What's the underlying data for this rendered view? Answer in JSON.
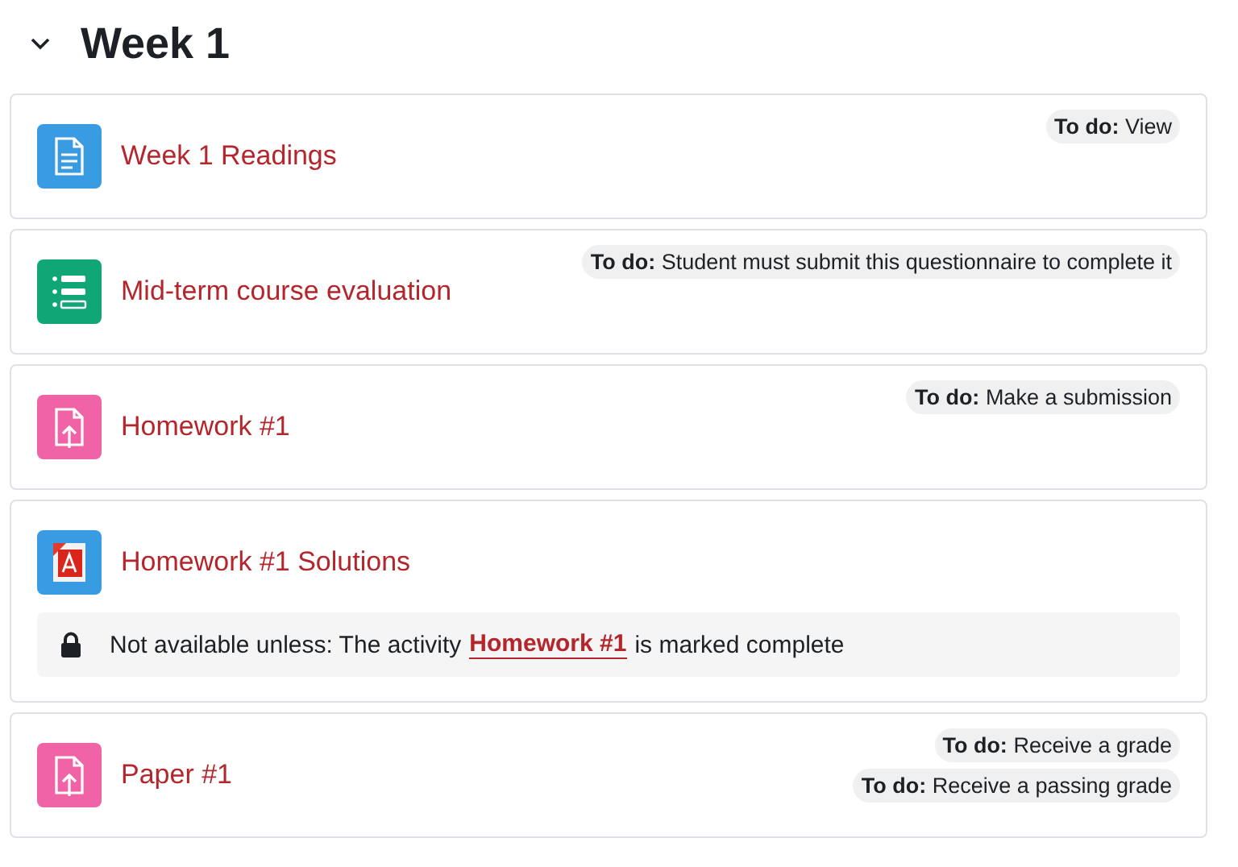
{
  "section": {
    "title": "Week 1",
    "expanded": true
  },
  "activities": [
    {
      "kind": "page",
      "title": "Week 1 Readings",
      "badges": [
        "**To do:** View"
      ]
    },
    {
      "kind": "feedback",
      "title": "Mid-term course evaluation",
      "badges": [
        "**To do:** Student must submit this questionnaire to complete it"
      ]
    },
    {
      "kind": "assignment",
      "title": "Homework #1",
      "badges": [
        "**To do:** Make a submission"
      ]
    },
    {
      "kind": "pdf",
      "title": "Homework #1 Solutions",
      "restriction": {
        "before": "Not available unless: The activity",
        "link": "Homework #1",
        "after": "is marked complete"
      }
    },
    {
      "kind": "assignment",
      "title": "Paper #1",
      "badges": [
        "**To do:** Receive a grade",
        "**To do:** Receive a passing grade"
      ]
    }
  ]
}
